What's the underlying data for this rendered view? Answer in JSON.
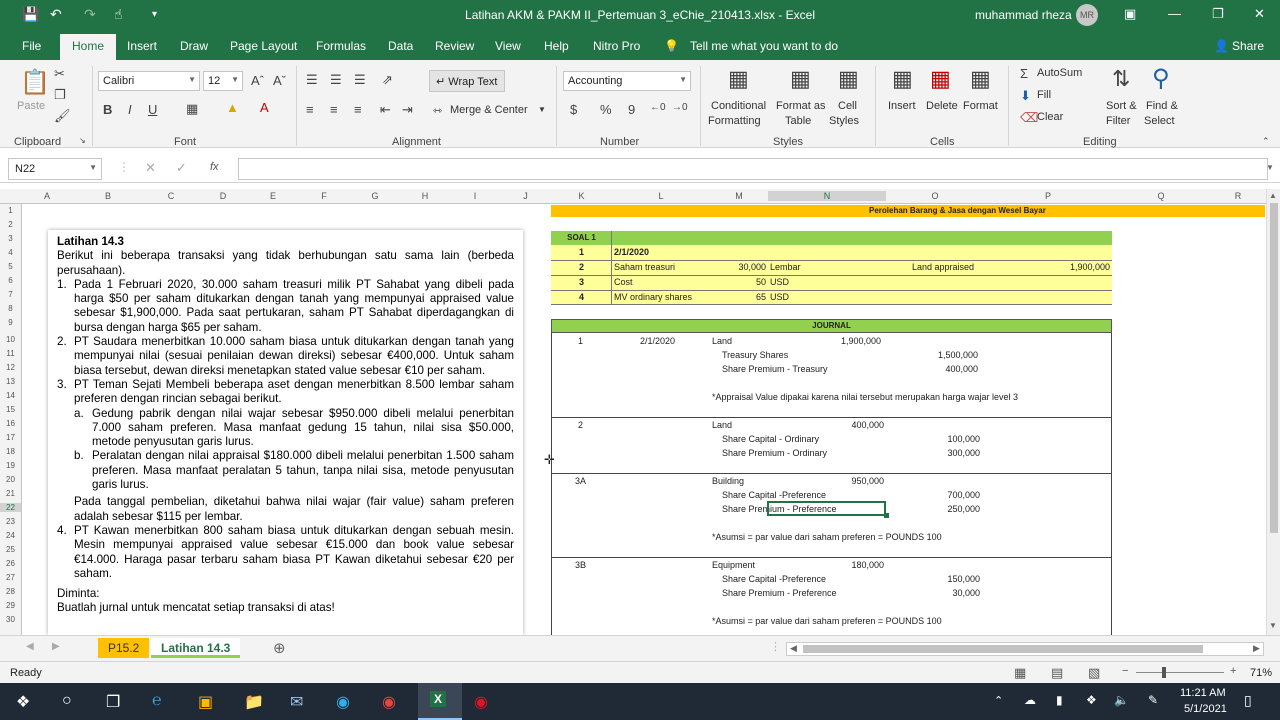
{
  "window": {
    "title": "Latihan AKM & PAKM II_Pertemuan 3_eChie_210413.xlsx  -  Excel",
    "user": "muhammad rheza",
    "avatar": "MR"
  },
  "tabs": [
    "File",
    "Home",
    "Insert",
    "Draw",
    "Page Layout",
    "Formulas",
    "Data",
    "Review",
    "View",
    "Help",
    "Nitro Pro"
  ],
  "tell_me": "Tell me what you want to do",
  "share": "Share",
  "ribbon": {
    "paste": "Paste",
    "clipboard": "Clipboard",
    "font_name": "Calibri",
    "font_size": "12",
    "font": "Font",
    "wrap_text": "Wrap Text",
    "merge_center": "Merge & Center",
    "alignment": "Alignment",
    "number_format": "Accounting",
    "number": "Number",
    "cond_fmt_1": "Conditional",
    "cond_fmt_2": "Formatting",
    "fmt_table_1": "Format as",
    "fmt_table_2": "Table",
    "cell_styles_1": "Cell",
    "cell_styles_2": "Styles",
    "styles": "Styles",
    "insert": "Insert",
    "delete": "Delete",
    "format": "Format",
    "cells": "Cells",
    "autosum": "AutoSum",
    "fill": "Fill",
    "clear": "Clear",
    "sort_1": "Sort &",
    "sort_2": "Filter",
    "find_1": "Find &",
    "find_2": "Select",
    "editing": "Editing",
    "bold": "B",
    "italic": "I",
    "underline": "U",
    "currency": "$",
    "percent": "%",
    "comma": "9"
  },
  "formula_bar": {
    "name_box": "N22",
    "fx": "fx",
    "formula": ""
  },
  "columns": [
    "A",
    "B",
    "C",
    "D",
    "E",
    "F",
    "G",
    "H",
    "I",
    "J",
    "K",
    "L",
    "M",
    "N",
    "O",
    "P",
    "Q",
    "R"
  ],
  "rows": [
    "1",
    "2",
    "3",
    "4",
    "5",
    "6",
    "7",
    "8",
    "9",
    "10",
    "11",
    "12",
    "13",
    "14",
    "15",
    "16",
    "17",
    "18",
    "19",
    "20",
    "21",
    "22",
    "23",
    "24",
    "25",
    "26",
    "27",
    "28",
    "29",
    "30"
  ],
  "doc": {
    "title": "Latihan 14.3",
    "intro": "Berikut ini beberapa transaksi yang tidak berhubungan satu sama lain (berbeda perusahaan).",
    "i1_n": "1.",
    "i1": "Pada 1 Februari 2020, 30.000 saham treasuri milik PT Sahabat yang dibeli pada harga $50 per saham ditukarkan dengan tanah yang mempunyai appraised value sebesar $1,900,000. Pada saat pertukaran, saham PT Sahabat diperdagangkan di bursa dengan harga $65 per saham.",
    "i2_n": "2.",
    "i2": "PT Saudara menerbitkan 10.000 saham biasa untuk ditukarkan dengan tanah yang mempunyai nilai (sesuai penilaian dewan direksi) sebesar €400,000. Untuk saham biasa tersebut, dewan direksi menetapkan stated value sebesar €10 per saham.",
    "i3_n": "3.",
    "i3": "PT Teman Sejati Membeli beberapa aset dengan menerbitkan 8.500 lembar saham preferen dengan rincian sebagai berikut.",
    "i3a_n": "a.",
    "i3a": "Gedung pabrik dengan nilai wajar sebesar $950.000 dibeli melalui penerbitan 7.000 saham preferen. Masa manfaat gedung 15 tahun, nilai sisa $50.000, metode penyusutan garis lurus.",
    "i3b_n": "b.",
    "i3b": "Peralatan dengan nilai appraisal $180.000 dibeli melalui penerbitan 1.500 saham preferen. Masa manfaat peralatan 5 tahun, tanpa nilai sisa, metode penyusutan garis lurus.",
    "i3c": "Pada tanggal pembelian, diketahui bahwa nilai wajar (fair value) saham preferen adalah sebesar $115 per lembar.",
    "i4_n": "4.",
    "i4": "PT Kawan menerbitkan 800 saham biasa untuk ditukarkan dengan sebuah mesin. Mesin mempunyai appraised value sebesar €15.000 dan book value sebesar €14.000. Haraga pasar terbaru saham biasa PT Kawan diketahui sebesar €20 per saham.",
    "asked": "Diminta:",
    "task": "Buatlah jurnal untuk mencatat setiap transaksi di atas!"
  },
  "sheet": {
    "banner": "Perolehan Barang & Jasa dengan Wesel Bayar",
    "soal": "SOAL 1",
    "s_date": "2/1/2020",
    "s_rows": [
      [
        "2",
        "Saham treasuri",
        "30,000",
        "Lembar",
        "Land appraised",
        "1,900,000"
      ],
      [
        "3",
        "Cost",
        "50",
        "USD",
        "",
        ""
      ],
      [
        "4",
        "MV ordinary shares",
        "65",
        "USD",
        "",
        ""
      ]
    ],
    "s_num1": "1",
    "journal": "JOURNAL",
    "j1": {
      "no": "1",
      "date": "2/1/2020",
      "l1": "Land",
      "v1": "1,900,000",
      "l2": "Treasury Shares",
      "v2": "1,500,000",
      "l3": "Share Premium - Treasury",
      "v3": "400,000",
      "note": "*Appraisal Value dipakai karena nilai tersebut merupakan harga wajar level 3"
    },
    "j2": {
      "no": "2",
      "l1": "Land",
      "v1": "400,000",
      "l2": "Share Capital - Ordinary",
      "v2": "100,000",
      "l3": "Share Premium - Ordinary",
      "v3": "300,000"
    },
    "j3a": {
      "no": "3A",
      "l1": "Building",
      "v1": "950,000",
      "l2": "Share Capital -Preference",
      "v2": "700,000",
      "l3": "Share Premium - Preference",
      "v3": "250,000",
      "note": "*Asumsi = par value dari saham preferen = POUNDS 100"
    },
    "j3b": {
      "no": "3B",
      "l1": "Equipment",
      "v1": "180,000",
      "l2": "Share Capital -Preference",
      "v2": "150,000",
      "l3": "Share Premium - Preference",
      "v3": "30,000",
      "note": "*Asumsi = par value dari saham preferen = POUNDS 100"
    }
  },
  "sheet_tabs": [
    "P15.2",
    "Latihan 14.3"
  ],
  "status": {
    "ready": "Ready",
    "zoom": "71%"
  },
  "clock": {
    "time": "11:21 AM",
    "date": "5/1/2021"
  },
  "colors": {
    "excel_green": "#217346",
    "yellow": "#ffff99",
    "green": "#92d050",
    "orange": "#ffc000"
  }
}
